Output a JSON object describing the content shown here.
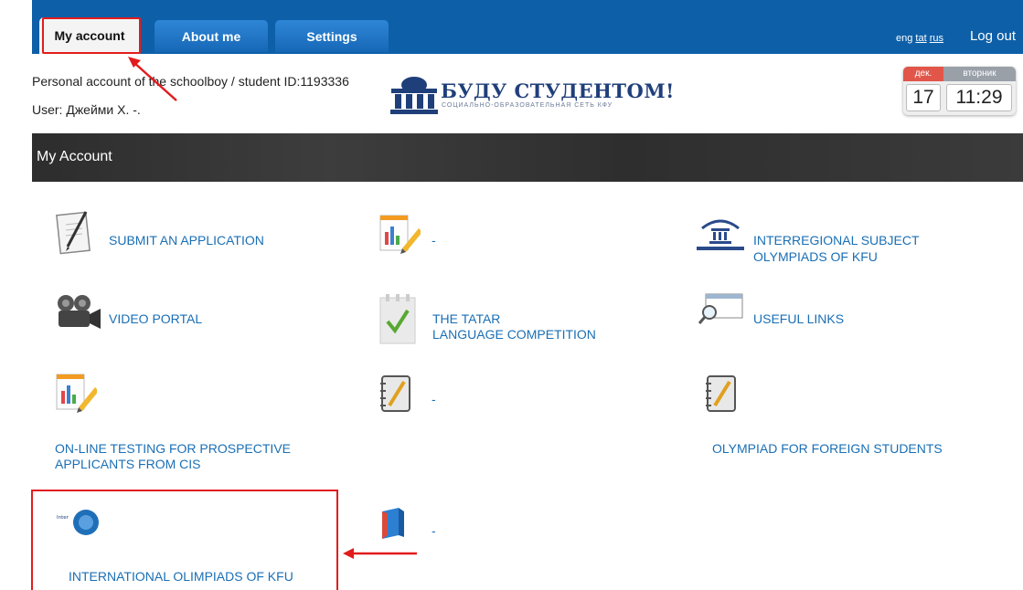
{
  "nav": {
    "tabs": [
      {
        "label": "My account"
      },
      {
        "label": "About me"
      },
      {
        "label": "Settings"
      }
    ],
    "lang_eng": "eng",
    "lang_tat": "tat",
    "lang_rus": "rus",
    "logout": "Log out"
  },
  "header": {
    "account_id_text": "Personal account of the schoolboy / student ID:1193336",
    "user_text": "User: Джейми Х. -."
  },
  "logo": {
    "title": "БУДУ СТУДЕНТОМ!",
    "subtitle": "СОЦИАЛЬНО-ОБРАЗОВАТЕЛЬНАЯ СЕТЬ КФУ"
  },
  "calendar": {
    "month": "дек.",
    "weekday": "вторник",
    "day": "17",
    "time": "11:29"
  },
  "section": {
    "title": "My Account"
  },
  "items": [
    {
      "label": "SUBMIT AN APPLICATION",
      "icon": "pencil-paper-icon"
    },
    {
      "label": "-",
      "icon": "report-chart-icon"
    },
    {
      "label": "INTERREGIONAL SUBJECT",
      "label2": "OLYMPIADS OF KFU",
      "icon": "olympiad-logo-icon"
    },
    {
      "label": "VIDEO PORTAL",
      "icon": "video-camera-icon"
    },
    {
      "label": "THE TATAR",
      "label2": "LANGUAGE COMPETITION",
      "icon": "checklist-icon"
    },
    {
      "label": "USEFUL LINKS",
      "icon": "search-window-icon"
    },
    {
      "label": "ON-LINE TESTING FOR PROSPECTIVE",
      "label2": "APPLICANTS FROM CIS",
      "icon": "report-chart-icon"
    },
    {
      "label": "-",
      "icon": "notebook-icon"
    },
    {
      "label": "OLYMPIAD FOR FOREIGN STUDENTS",
      "icon": "notebook-icon"
    },
    {
      "label": "INTERNATIONAL OLIMPIADS OF KFU",
      "icon": "international-olympiads-logo-icon"
    },
    {
      "label": "-",
      "icon": "book-icon"
    }
  ],
  "intl_logo_text": "International olympiads of KFU",
  "colors": {
    "nav_blue": "#0d5fa8",
    "link_blue": "#1a6fb5",
    "annotation_red": "#e21c1c",
    "section_dark": "#333333"
  }
}
